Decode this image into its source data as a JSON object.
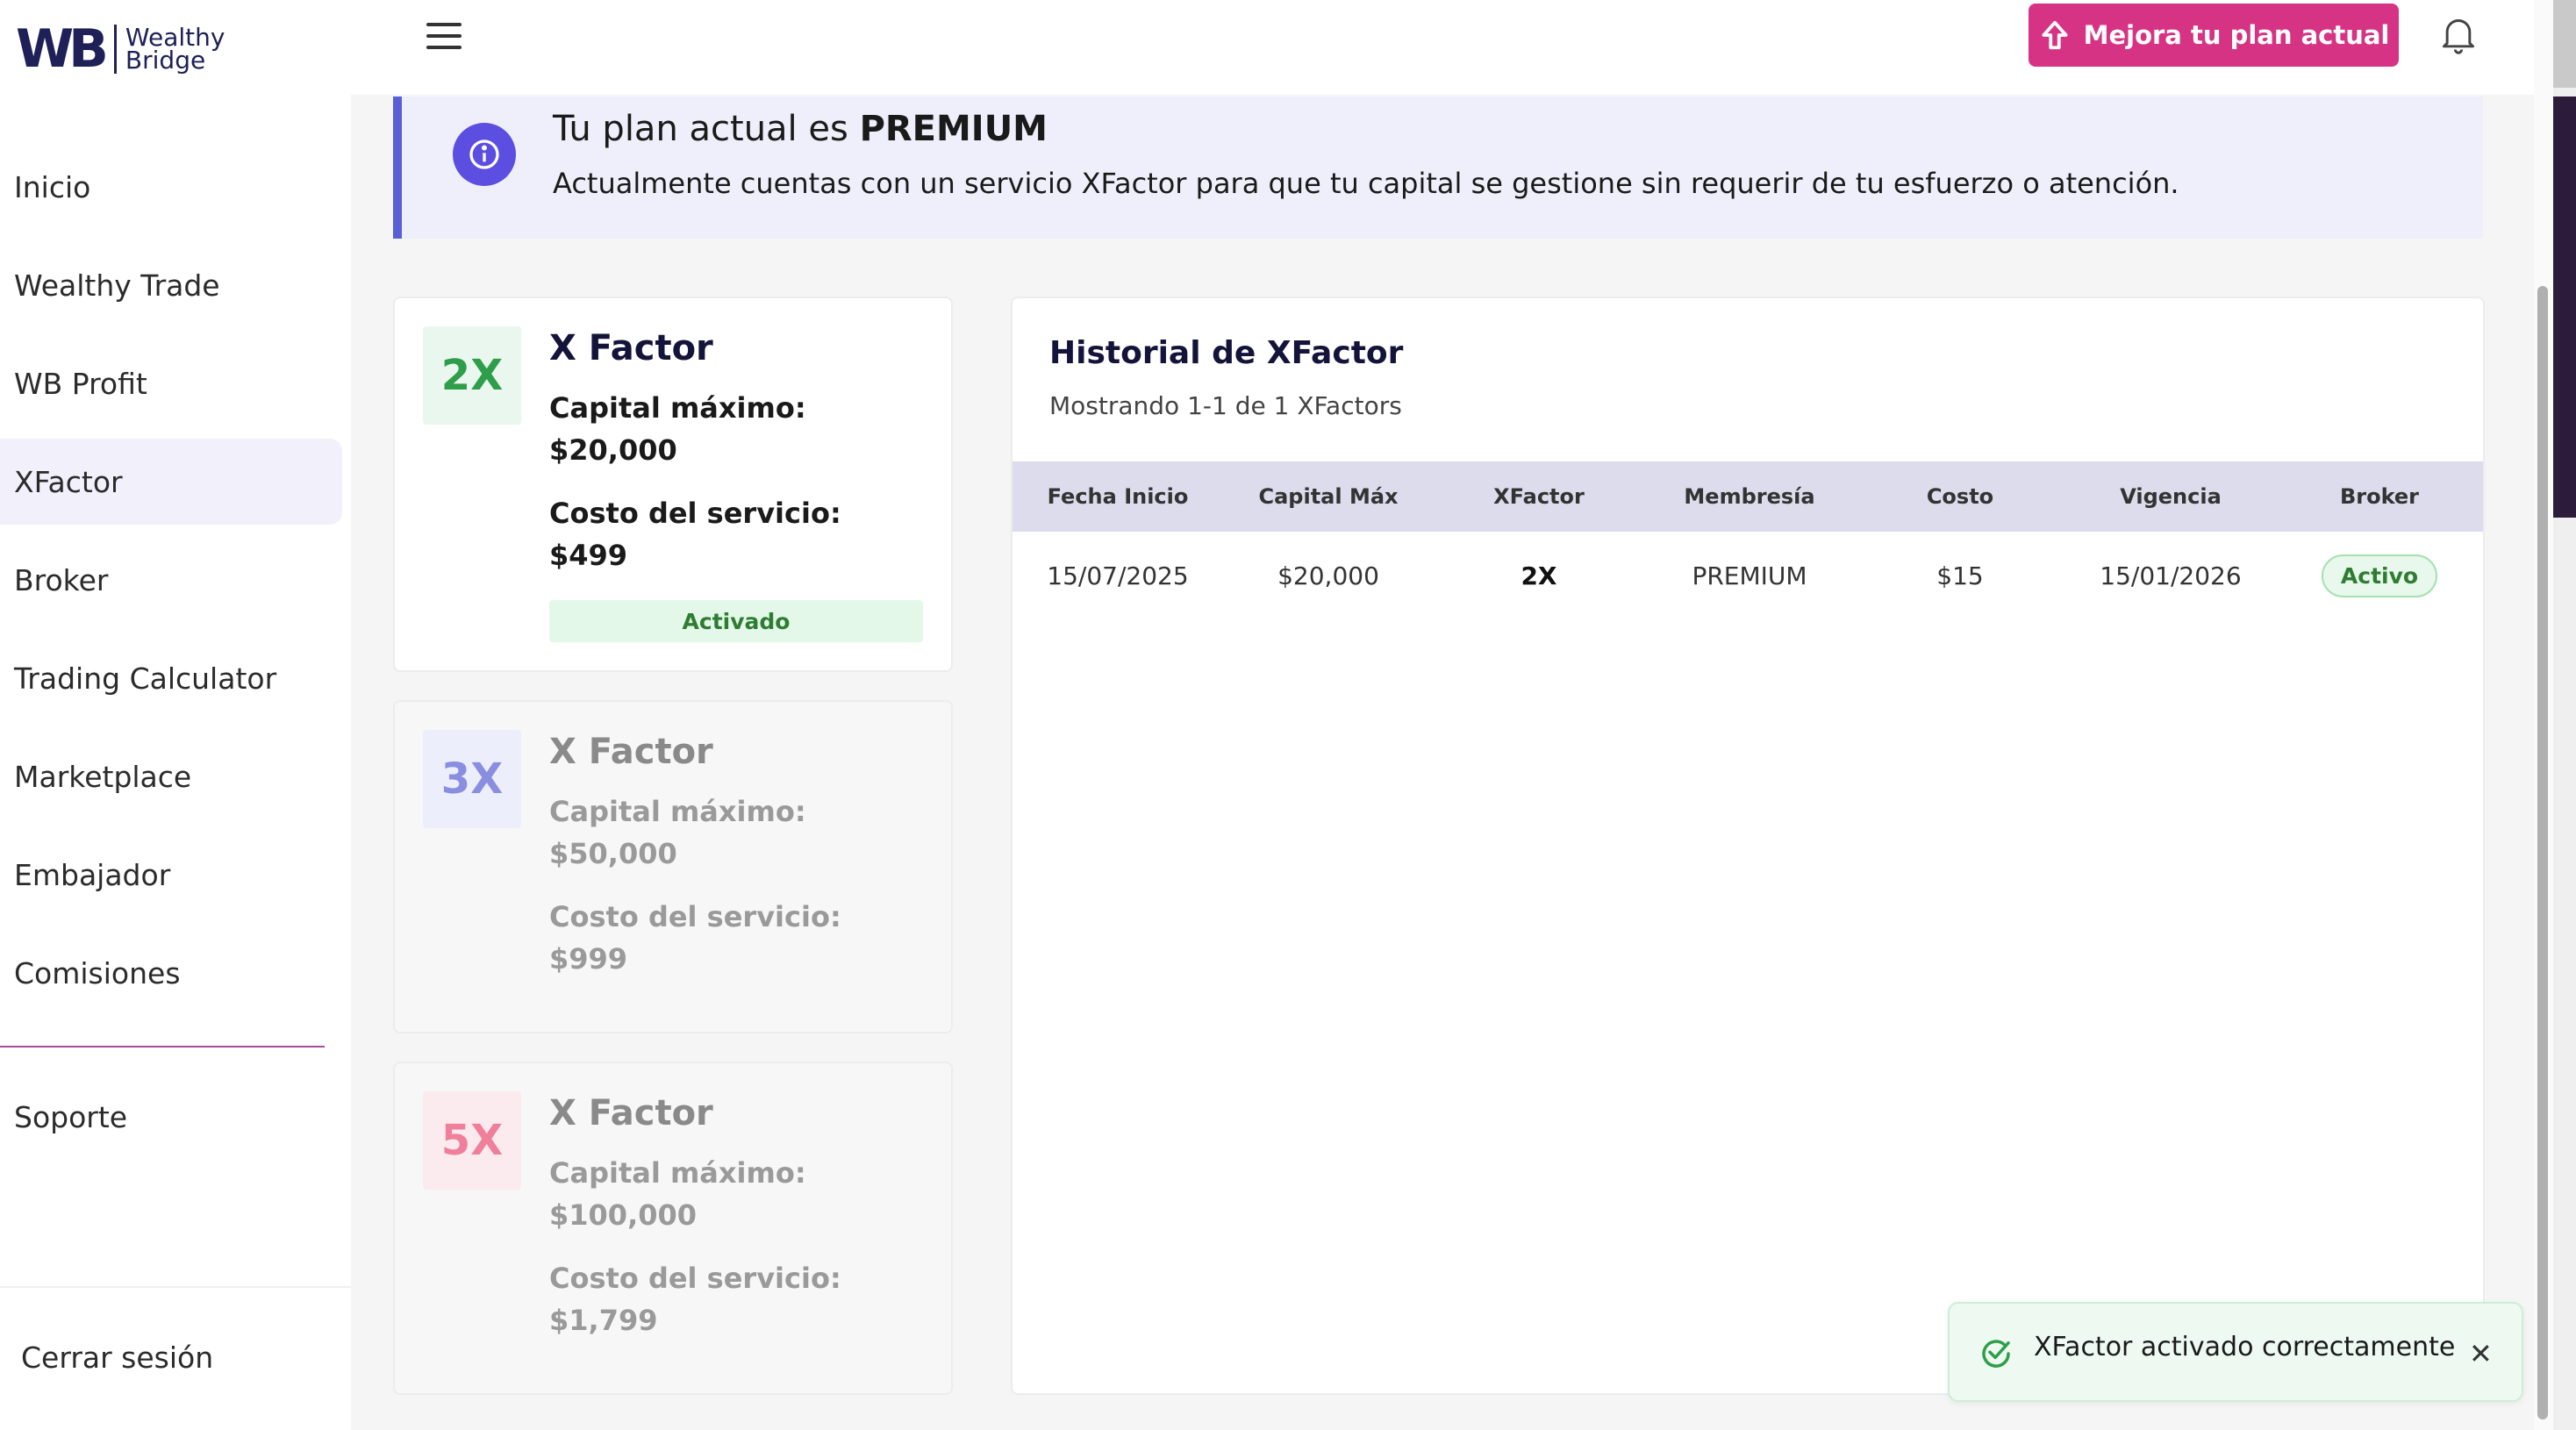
{
  "brand": {
    "mark": "WB",
    "line1": "Wealthy",
    "line2": "Bridge"
  },
  "sidebar": {
    "items": [
      {
        "label": "Inicio",
        "active": false
      },
      {
        "label": "Wealthy Trade",
        "active": false
      },
      {
        "label": "WB Profit",
        "active": false
      },
      {
        "label": "XFactor",
        "active": true
      },
      {
        "label": "Broker",
        "active": false
      },
      {
        "label": "Trading Calculator",
        "active": false
      },
      {
        "label": "Marketplace",
        "active": false
      },
      {
        "label": "Embajador",
        "active": false
      },
      {
        "label": "Comisiones",
        "active": false
      }
    ],
    "support": "Soporte",
    "logout": "Cerrar sesión"
  },
  "topbar": {
    "upgrade_label": "Mejora tu plan actual",
    "accent": "#d63384"
  },
  "banner": {
    "title_prefix": "Tu plan actual es ",
    "title_plan": "PREMIUM",
    "text": "Actualmente cuentas con un servicio XFactor para que tu capital se gestione sin requerir de tu esfuerzo o atención."
  },
  "xfactors": [
    {
      "badge": "2X",
      "title": "X Factor",
      "capital_label": "Capital máximo:",
      "capital": "$20,000",
      "cost_label": "Costo del servicio:",
      "cost": "$499",
      "status": "Activado",
      "color": "#2e9e4a",
      "bg": "#eaf7ee"
    },
    {
      "badge": "3X",
      "title": "X Factor",
      "capital_label": "Capital máximo:",
      "capital": "$50,000",
      "cost_label": "Costo del servicio:",
      "cost": "$999",
      "status": "",
      "color": "#8a8ee0",
      "bg": "#eceefb"
    },
    {
      "badge": "5X",
      "title": "X Factor",
      "capital_label": "Capital máximo:",
      "capital": "$100,000",
      "cost_label": "Costo del servicio:",
      "cost": "$1,799",
      "status": "",
      "color": "#ef7f9a",
      "bg": "#fbeaee"
    }
  ],
  "history": {
    "title": "Historial de XFactor",
    "subtitle": "Mostrando 1-1 de 1 XFactors",
    "columns": [
      "Fecha Inicio",
      "Capital Máx",
      "XFactor",
      "Membresía",
      "Costo",
      "Vigencia",
      "Broker"
    ],
    "rows": [
      [
        "15/07/2025",
        "$20,000",
        "2X",
        "PREMIUM",
        "$15",
        "15/01/2026",
        "Activo"
      ]
    ]
  },
  "toast": {
    "message": "XFactor activado correctamente"
  }
}
